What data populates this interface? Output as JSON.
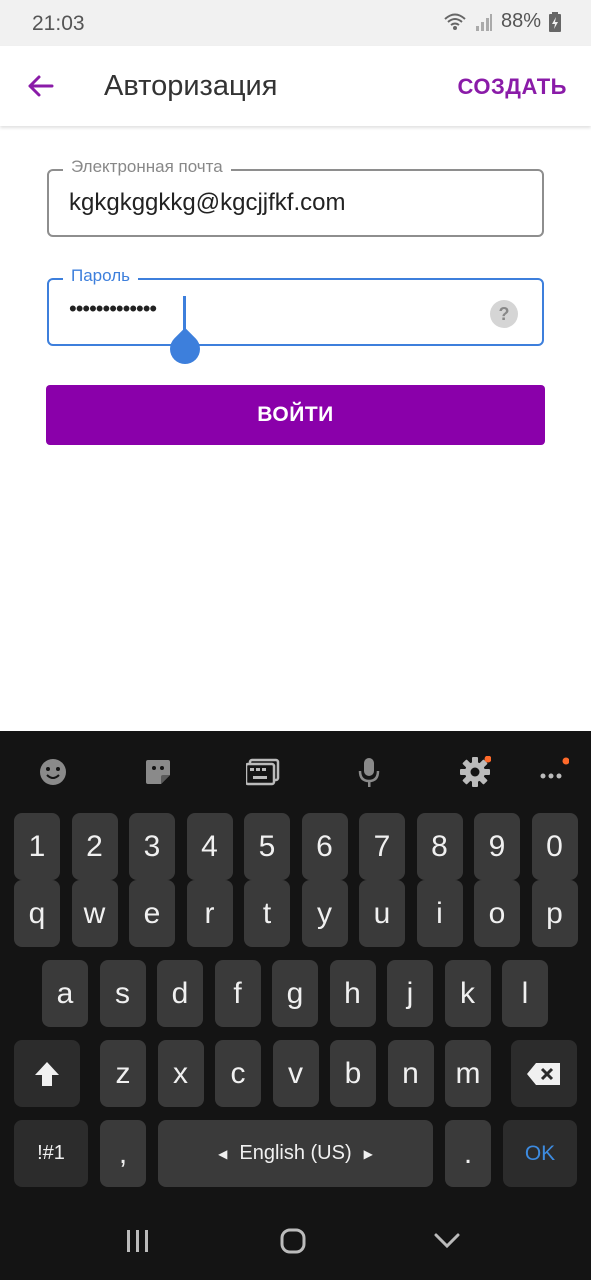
{
  "status_bar": {
    "time": "21:03",
    "battery": "88%"
  },
  "app_bar": {
    "title": "Авторизация",
    "action": "СОЗДАТЬ"
  },
  "form": {
    "email": {
      "label": "Электронная почта",
      "value": "kgkgkggkkg@kgcjjfkf.com"
    },
    "password": {
      "label": "Пароль",
      "value": "•••••••••••••",
      "help": "?"
    },
    "submit_label": "ВОЙТИ"
  },
  "keyboard": {
    "toolbar": [
      "emoji-icon",
      "sticker-icon",
      "keyboard-icon",
      "microphone-icon",
      "settings-icon",
      "more-icon"
    ],
    "row_numbers": [
      "1",
      "2",
      "3",
      "4",
      "5",
      "6",
      "7",
      "8",
      "9",
      "0"
    ],
    "row_top": [
      "q",
      "w",
      "e",
      "r",
      "t",
      "y",
      "u",
      "i",
      "o",
      "p"
    ],
    "row_middle": [
      "a",
      "s",
      "d",
      "f",
      "g",
      "h",
      "j",
      "k",
      "l"
    ],
    "row_bottom": [
      "z",
      "x",
      "c",
      "v",
      "b",
      "n",
      "m"
    ],
    "symbols_label": "!#1",
    "comma": ",",
    "space_label": "English (US)",
    "period": ".",
    "ok_label": "OK",
    "accent_color": "#3d8be0"
  },
  "colors": {
    "brand": "#8a00aa",
    "focus": "#3d7fdc"
  }
}
